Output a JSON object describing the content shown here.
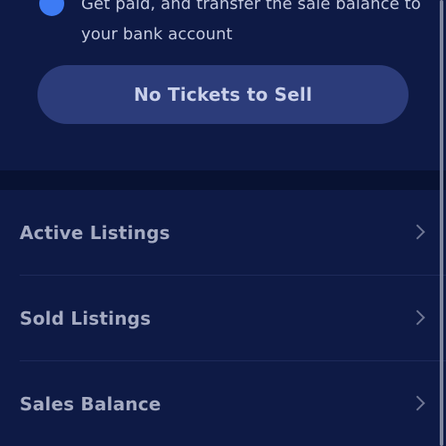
{
  "info_step": {
    "line1": "Get paid, and transfer the sale balance to",
    "line2": "your bank account"
  },
  "cta": {
    "label": "No Tickets to Sell"
  },
  "menu": {
    "items": [
      {
        "label": "Active Listings"
      },
      {
        "label": "Sold Listings"
      },
      {
        "label": "Sales Balance"
      }
    ]
  },
  "colors": {
    "background": "#0e1a45",
    "button": "#2c3c7a",
    "accent": "#3d7bf4"
  }
}
